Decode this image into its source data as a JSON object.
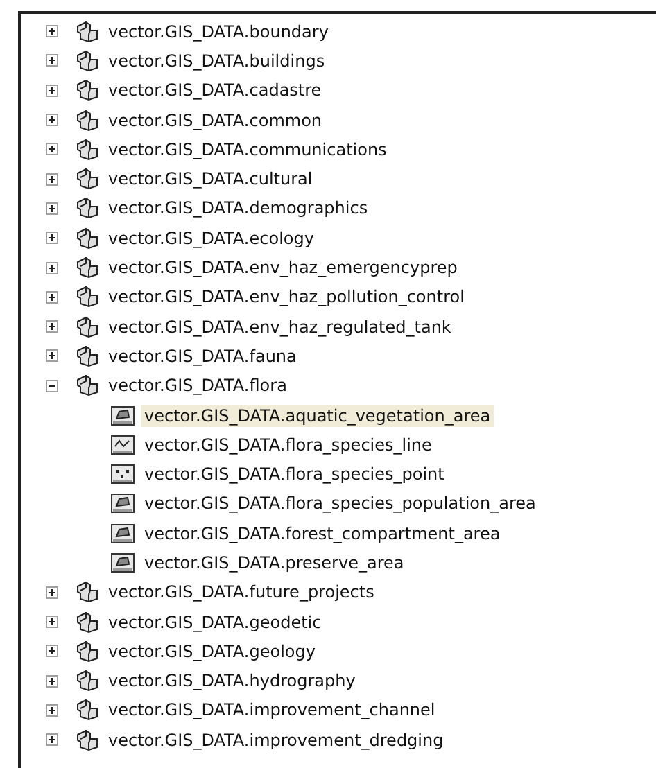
{
  "tree": [
    {
      "label": "vector.GIS_DATA.boundary",
      "expanded": false,
      "selected": false
    },
    {
      "label": "vector.GIS_DATA.buildings",
      "expanded": false,
      "selected": false
    },
    {
      "label": "vector.GIS_DATA.cadastre",
      "expanded": false,
      "selected": false
    },
    {
      "label": "vector.GIS_DATA.common",
      "expanded": false,
      "selected": false
    },
    {
      "label": "vector.GIS_DATA.communications",
      "expanded": false,
      "selected": false
    },
    {
      "label": "vector.GIS_DATA.cultural",
      "expanded": false,
      "selected": false
    },
    {
      "label": "vector.GIS_DATA.demographics",
      "expanded": false,
      "selected": false
    },
    {
      "label": "vector.GIS_DATA.ecology",
      "expanded": false,
      "selected": false
    },
    {
      "label": "vector.GIS_DATA.env_haz_emergencyprep",
      "expanded": false,
      "selected": false
    },
    {
      "label": "vector.GIS_DATA.env_haz_pollution_control",
      "expanded": false,
      "selected": false
    },
    {
      "label": "vector.GIS_DATA.env_haz_regulated_tank",
      "expanded": false,
      "selected": false
    },
    {
      "label": "vector.GIS_DATA.fauna",
      "expanded": false,
      "selected": false
    },
    {
      "label": "vector.GIS_DATA.flora",
      "expanded": true,
      "selected": false,
      "children": [
        {
          "label": "vector.GIS_DATA.aquatic_vegetation_area",
          "kind": "polygon",
          "selected": true
        },
        {
          "label": "vector.GIS_DATA.flora_species_line",
          "kind": "line",
          "selected": false
        },
        {
          "label": "vector.GIS_DATA.flora_species_point",
          "kind": "point",
          "selected": false
        },
        {
          "label": "vector.GIS_DATA.flora_species_population_area",
          "kind": "polygon",
          "selected": false
        },
        {
          "label": "vector.GIS_DATA.forest_compartment_area",
          "kind": "polygon",
          "selected": false
        },
        {
          "label": "vector.GIS_DATA.preserve_area",
          "kind": "polygon",
          "selected": false
        }
      ]
    },
    {
      "label": "vector.GIS_DATA.future_projects",
      "expanded": false,
      "selected": false
    },
    {
      "label": "vector.GIS_DATA.geodetic",
      "expanded": false,
      "selected": false
    },
    {
      "label": "vector.GIS_DATA.geology",
      "expanded": false,
      "selected": false
    },
    {
      "label": "vector.GIS_DATA.hydrography",
      "expanded": false,
      "selected": false
    },
    {
      "label": "vector.GIS_DATA.improvement_channel",
      "expanded": false,
      "selected": false
    },
    {
      "label": "vector.GIS_DATA.improvement_dredging",
      "expanded": false,
      "selected": false
    }
  ]
}
